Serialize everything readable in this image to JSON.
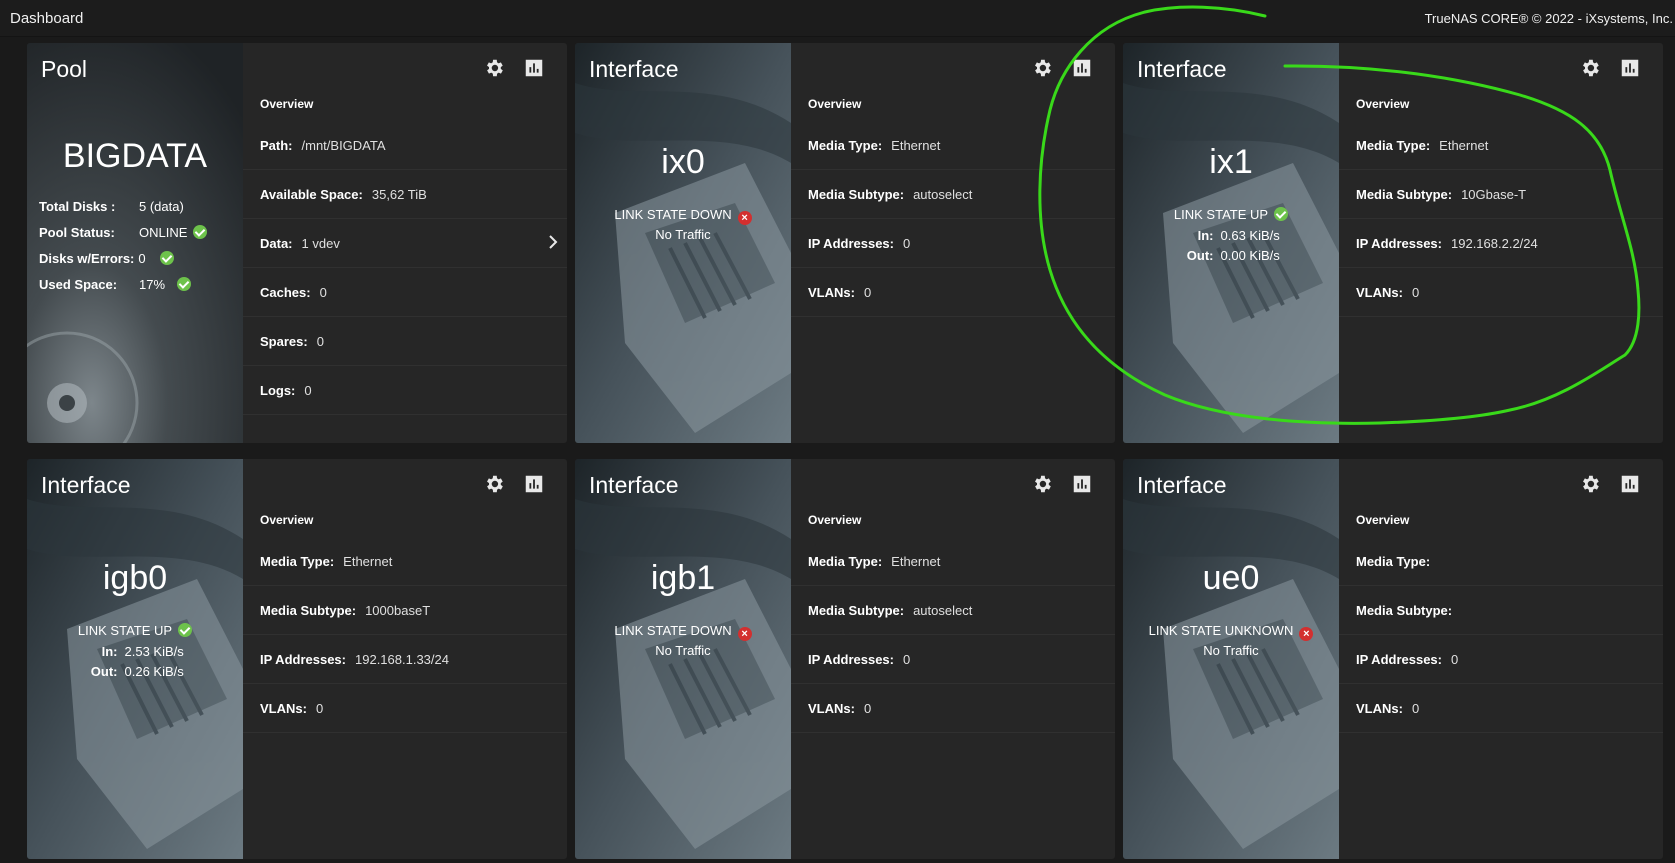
{
  "header": {
    "title": "Dashboard",
    "copyright": "TrueNAS CORE® © 2022 - iXsystems, Inc."
  },
  "colors": {
    "ok": "#6dc24b",
    "error": "#d32f2f",
    "annotation": "#39d91a"
  },
  "overview_label": "Overview",
  "pool": {
    "card_title": "Pool",
    "name": "BIGDATA",
    "stats": [
      {
        "label": "Total Disks :",
        "value": "5 (data)",
        "icon": ""
      },
      {
        "label": "Pool Status:",
        "value": "ONLINE",
        "icon": "check-circle-icon"
      },
      {
        "label": "Disks w/Errors:",
        "value": "0",
        "icon": "check-circle-icon"
      },
      {
        "label": "Used Space:",
        "value": "17%",
        "icon": "check-circle-icon"
      }
    ],
    "details": [
      {
        "label": "Path:",
        "value": "/mnt/BIGDATA"
      },
      {
        "label": "Available Space:",
        "value": "35,62 TiB"
      },
      {
        "label": "Data:",
        "value": "1 vdev"
      },
      {
        "label": "Caches:",
        "value": "0"
      },
      {
        "label": "Spares:",
        "value": "0"
      },
      {
        "label": "Logs:",
        "value": "0"
      }
    ]
  },
  "interfaces": [
    {
      "card_title": "Interface",
      "name": "ix0",
      "link_state": "LINK STATE DOWN",
      "link_ok": false,
      "traffic_text": "No Traffic",
      "in_label": "",
      "in_value": "",
      "out_label": "",
      "out_value": "",
      "details": [
        {
          "label": "Media Type:",
          "value": "Ethernet"
        },
        {
          "label": "Media Subtype:",
          "value": "autoselect"
        },
        {
          "label": "IP Addresses:",
          "value": "0"
        },
        {
          "label": "VLANs:",
          "value": "0"
        }
      ]
    },
    {
      "card_title": "Interface",
      "name": "ix1",
      "link_state": "LINK STATE UP",
      "link_ok": true,
      "traffic_text": "",
      "in_label": "In:",
      "in_value": "0.63 KiB/s",
      "out_label": "Out:",
      "out_value": "0.00 KiB/s",
      "details": [
        {
          "label": "Media Type:",
          "value": "Ethernet"
        },
        {
          "label": "Media Subtype:",
          "value": "10Gbase-T"
        },
        {
          "label": "IP Addresses:",
          "value": "192.168.2.2/24"
        },
        {
          "label": "VLANs:",
          "value": "0"
        }
      ]
    },
    {
      "card_title": "Interface",
      "name": "igb0",
      "link_state": "LINK STATE UP",
      "link_ok": true,
      "traffic_text": "",
      "in_label": "In:",
      "in_value": "2.53 KiB/s",
      "out_label": "Out:",
      "out_value": "0.26 KiB/s",
      "details": [
        {
          "label": "Media Type:",
          "value": "Ethernet"
        },
        {
          "label": "Media Subtype:",
          "value": "1000baseT"
        },
        {
          "label": "IP Addresses:",
          "value": "192.168.1.33/24"
        },
        {
          "label": "VLANs:",
          "value": "0"
        }
      ]
    },
    {
      "card_title": "Interface",
      "name": "igb1",
      "link_state": "LINK STATE DOWN",
      "link_ok": false,
      "traffic_text": "No Traffic",
      "in_label": "",
      "in_value": "",
      "out_label": "",
      "out_value": "",
      "details": [
        {
          "label": "Media Type:",
          "value": "Ethernet"
        },
        {
          "label": "Media Subtype:",
          "value": "autoselect"
        },
        {
          "label": "IP Addresses:",
          "value": "0"
        },
        {
          "label": "VLANs:",
          "value": "0"
        }
      ]
    },
    {
      "card_title": "Interface",
      "name": "ue0",
      "link_state": "LINK STATE UNKNOWN",
      "link_ok": false,
      "traffic_text": "No Traffic",
      "in_label": "",
      "in_value": "",
      "out_label": "",
      "out_value": "",
      "details": [
        {
          "label": "Media Type:",
          "value": ""
        },
        {
          "label": "Media Subtype:",
          "value": ""
        },
        {
          "label": "IP Addresses:",
          "value": "0"
        },
        {
          "label": "VLANs:",
          "value": "0"
        }
      ]
    }
  ]
}
